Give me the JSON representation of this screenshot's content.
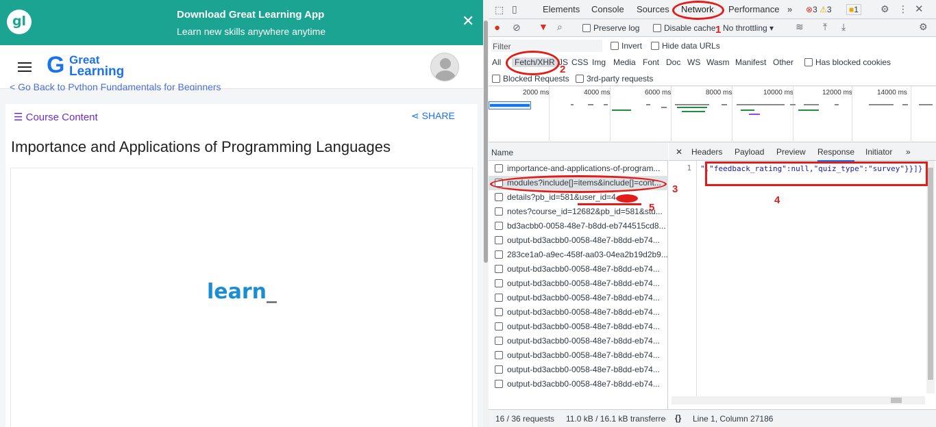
{
  "banner": {
    "title": "Download Great Learning App",
    "subtitle": "Learn new skills anywhere anytime",
    "close": "✕",
    "logo": "gl"
  },
  "header": {
    "brand_line1": "Great",
    "brand_line2": "Learning",
    "brand_mark": "G",
    "breadcrumb": "< Go Back to Python Fundamentals for Beginners"
  },
  "course": {
    "content_label": "Course Content",
    "share_label": "SHARE",
    "title": "Importance and Applications of Programming Languages",
    "player_text": "learn",
    "player_cursor": "_"
  },
  "devtools": {
    "tabs": [
      "Elements",
      "Console",
      "Sources",
      "Network",
      "Performance"
    ],
    "more": "»",
    "counts": {
      "errors": "3",
      "warnings": "3",
      "issues": "1"
    },
    "toolbar": {
      "preserve_log": "Preserve log",
      "disable_cache": "Disable cache",
      "throttling": "No throttling"
    },
    "filter": {
      "placeholder": "Filter",
      "invert": "Invert",
      "hide_data_urls": "Hide data URLs"
    },
    "types": [
      "All",
      "Fetch/XHR",
      "JS",
      "CSS",
      "Img",
      "Media",
      "Font",
      "Doc",
      "WS",
      "Wasm",
      "Manifest",
      "Other"
    ],
    "has_blocked_cookies": "Has blocked cookies",
    "blocked_requests": "Blocked Requests",
    "third_party": "3rd-party requests",
    "timeline_ticks": [
      "2000 ms",
      "4000 ms",
      "6000 ms",
      "8000 ms",
      "10000 ms",
      "12000 ms",
      "14000 ms"
    ],
    "name_header": "Name",
    "requests": [
      "importance-and-applications-of-program...",
      "modules?include[]=items&include[]=cont...",
      "details?pb_id=581&user_id=4",
      "notes?course_id=12682&pb_id=581&stu...",
      "bd3acbb0-0058-48e7-b8dd-eb744515cd8...",
      "output-bd3acbb0-0058-48e7-b8dd-eb74...",
      "283ce1a0-a9ec-458f-aa03-04ea2b19d2b9...",
      "output-bd3acbb0-0058-48e7-b8dd-eb74...",
      "output-bd3acbb0-0058-48e7-b8dd-eb74...",
      "output-bd3acbb0-0058-48e7-b8dd-eb74...",
      "output-bd3acbb0-0058-48e7-b8dd-eb74...",
      "output-bd3acbb0-0058-48e7-b8dd-eb74...",
      "output-bd3acbb0-0058-48e7-b8dd-eb74...",
      "output-bd3acbb0-0058-48e7-b8dd-eb74...",
      "output-bd3acbb0-0058-48e7-b8dd-eb74...",
      "output-bd3acbb0-0058-48e7-b8dd-eb74..."
    ],
    "detail_tabs": [
      "Headers",
      "Payload",
      "Preview",
      "Response",
      "Initiator"
    ],
    "response": {
      "line_no": "1",
      "code": "\",\"feedback_rating\":null,\"quiz_type\":\"survey\"}}]}"
    },
    "status": {
      "requests": "16 / 36 requests",
      "transferred": "11.0 kB / 16.1 kB transferred",
      "position": "Line 1, Column 27186",
      "pretty": "{}"
    }
  },
  "annotations": [
    "1",
    "2",
    "3",
    "4",
    "5"
  ]
}
